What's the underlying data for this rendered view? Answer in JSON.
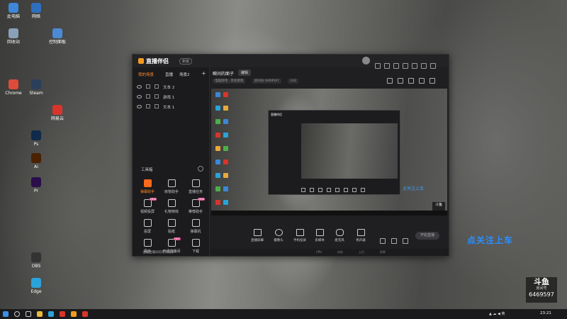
{
  "desktop": {
    "icons": [
      {
        "label": "此电脑",
        "color": "#3d86d8"
      },
      {
        "label": "网络",
        "color": "#2e6fbf"
      },
      {
        "label": "回收站",
        "color": "#8aa0b8"
      },
      {
        "label": "控制面板",
        "color": "#4b8bd6"
      },
      {
        "label": "Chrome",
        "color": "#dd4b39"
      },
      {
        "label": "Steam",
        "color": "#2a3f5a"
      },
      {
        "label": "网易云",
        "color": "#d9342b"
      },
      {
        "label": "Ps",
        "color": "#0f2a4a"
      },
      {
        "label": "Ai",
        "color": "#4a2200"
      },
      {
        "label": "Pr",
        "color": "#2a0f4a"
      },
      {
        "label": "OBS",
        "color": "#333"
      },
      {
        "label": "Edge",
        "color": "#2aa3d8"
      }
    ],
    "follow_text": "点关注上车",
    "douyu": {
      "logo": "斗鱼",
      "sub": "房间号",
      "room": "6469597"
    }
  },
  "app": {
    "logo": "直播伴侣",
    "version": "新版",
    "tabs": [
      "我的场景",
      "直播",
      "场景2"
    ],
    "sources": [
      "文本 2",
      "游戏 1",
      "文本 1"
    ],
    "toolbox": {
      "title": "工具箱",
      "items": [
        {
          "label": "弹幕助手",
          "hot": true
        },
        {
          "label": "房管助手",
          "hot": false
        },
        {
          "label": "直播任务",
          "hot": false
        },
        {
          "label": "视频投屏",
          "hot": false,
          "badge": "NEW"
        },
        {
          "label": "礼物特效",
          "hot": false
        },
        {
          "label": "推荐助手",
          "hot": false,
          "badge": "NEW"
        },
        {
          "label": "投屏",
          "hot": false
        },
        {
          "label": "贴纸",
          "hot": false
        },
        {
          "label": "弹幕机",
          "hot": false
        },
        {
          "label": "更多",
          "hot": false
        },
        {
          "label": "开通直播间",
          "hot": false,
          "badge": "HOT"
        },
        {
          "label": "下载",
          "hot": false
        }
      ],
      "promo": "主播直播间的贵宾助手"
    },
    "room_title": "瞬间的面子",
    "edit_label": "编辑",
    "room_meta": [
      "电脑游戏 - 其他游戏",
      "房间号 6469597",
      "142"
    ],
    "controls": [
      "直播屏幕",
      "摄像头",
      "手机投屏",
      "多媒体",
      "麦克风",
      "扬声器"
    ],
    "start_button": "开始直播",
    "status": [
      "CPU",
      "内存",
      "上行",
      "码率"
    ],
    "preview_follow": "点关注上车"
  },
  "taskbar": {
    "clock": "23:21"
  }
}
